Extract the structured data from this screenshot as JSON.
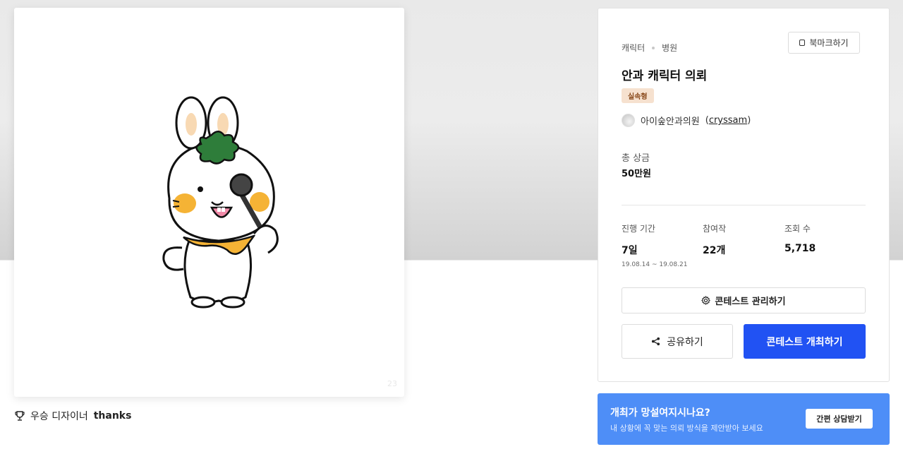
{
  "hero": {
    "watermark": "23",
    "winner_prefix": "우승 디자이너",
    "winner_name": "thanks"
  },
  "contest": {
    "category": "캐릭터",
    "subcategory": "병원",
    "bookmark_label": "북마크하기",
    "title": "안과 캐릭터 의뢰",
    "type_badge": "실속형",
    "host_name": "아이숲안과의원",
    "host_user": "cryssam",
    "prize_label": "총 상금",
    "prize_value": "50만원",
    "stats": {
      "period_label": "진행 기간",
      "period_value": "7일",
      "period_dates": "19.08.14 ~ 19.08.21",
      "entries_label": "참여작",
      "entries_value": "22개",
      "views_label": "조회 수",
      "views_value": "5,718"
    },
    "manage_label": "콘테스트 관리하기",
    "share_label": "공유하기",
    "host_contest_label": "콘테스트 개최하기"
  },
  "promo": {
    "title": "개최가 망설여지시나요?",
    "subtitle": "내 상황에 꼭 맞는 의뢰 방식을 제안받아 보세요",
    "button_label": "간편 상담받기"
  },
  "colors": {
    "primary": "#2152f3",
    "promo_bg": "#4e8ef7",
    "badge_bg": "#f6e1cf",
    "badge_text": "#8a4a1c",
    "mascot_leaf": "#2e7d3a",
    "mascot_scarf": "#f5b335"
  },
  "icons": {
    "bookmark": "bookmark-icon",
    "gear": "gear-icon",
    "share": "share-icon",
    "trophy": "trophy-icon"
  }
}
